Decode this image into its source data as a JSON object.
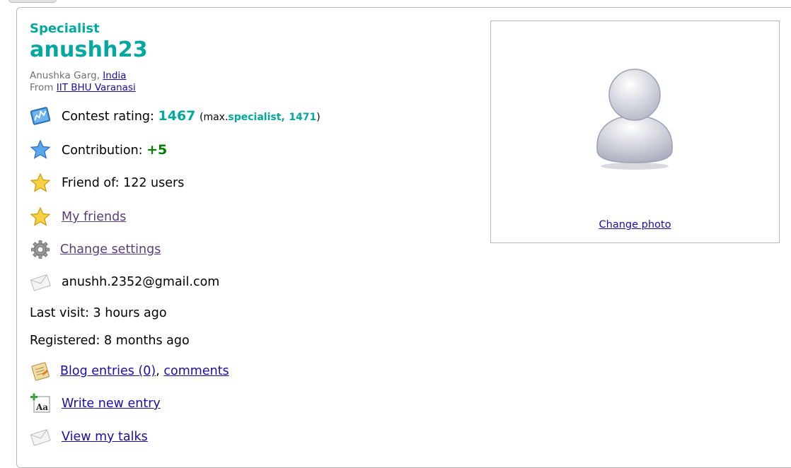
{
  "profile": {
    "rank": "Specialist",
    "handle": "anushh23",
    "full_name": "Anushka Garg",
    "name_separator": ",",
    "country": "India",
    "from_label": "From",
    "organization": "IIT BHU Varanasi",
    "contest_rating_label": "Contest rating:",
    "contest_rating_value": "1467",
    "max_open": "(max.",
    "max_rank": "specialist,",
    "max_rating": "1471",
    "max_close": ")",
    "contribution_label": "Contribution:",
    "contribution_value": "+5",
    "friend_of": "Friend of: 122 users",
    "my_friends": "My friends",
    "change_settings": "Change settings",
    "email": "anushh.2352@gmail.com",
    "last_visit": "Last visit: 3 hours ago",
    "registered": "Registered: 8 months ago",
    "blog_entries": "Blog entries (0)",
    "comma": ",",
    "comments": "comments",
    "write_entry": "Write new entry",
    "view_talks": "View my talks",
    "change_photo": "Change photo"
  },
  "colors": {
    "specialist": "#03a89e",
    "contribution": "#008000",
    "link": "#1a0dab",
    "visited_link": "#5a3d7b"
  },
  "icons": [
    "rating-chart-icon",
    "blue-star-icon",
    "gold-star-icon",
    "gear-icon",
    "envelope-icon",
    "blog-notebook-icon",
    "write-entry-icon",
    "avatar-placeholder-icon"
  ]
}
